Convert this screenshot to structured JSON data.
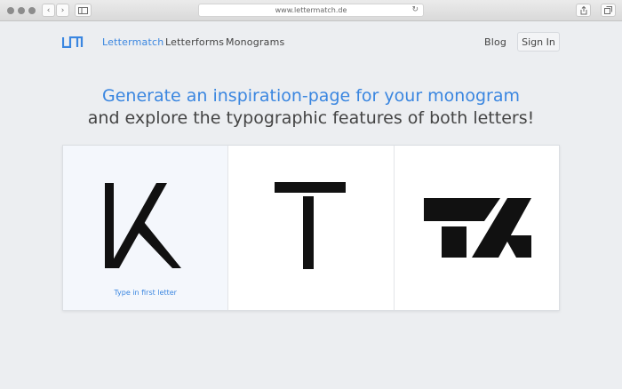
{
  "browser": {
    "url": "www.lettermatch.de",
    "back_icon": "chevron-left-icon",
    "forward_icon": "chevron-right-icon",
    "sidebar_icon": "sidebar-icon",
    "reload_icon": "reload-icon",
    "share_icon": "share-icon",
    "tabs_icon": "tabs-icon"
  },
  "nav": {
    "logo_icon": "lettermatch-logo-icon",
    "items": [
      {
        "label": "Lettermatch",
        "active": true
      },
      {
        "label": "Letterforms",
        "active": false
      },
      {
        "label": "Monograms",
        "active": false
      }
    ],
    "blog_label": "Blog",
    "signin_label": "Sign In"
  },
  "headline": {
    "line1": "Generate an inspiration-page for your monogram",
    "line2": "and explore the typographic features of both letters!"
  },
  "cards": [
    {
      "letter": "K",
      "hint": "Type in first letter"
    },
    {
      "letter": "T"
    },
    {
      "letter": "TK",
      "kind": "monogram"
    }
  ],
  "colors": {
    "accent": "#3a86e0",
    "text": "#444444",
    "glyph": "#111111"
  }
}
